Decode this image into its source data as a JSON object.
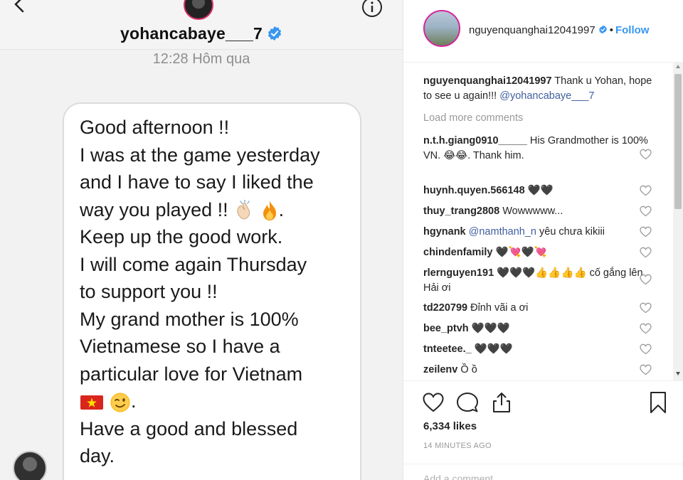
{
  "dm": {
    "username": "yohancabaye___7",
    "timestamp": "12:28 Hôm qua",
    "message": {
      "l1": "Good afternoon !!",
      "l2": "I was at the game yesterday",
      "l3": "and I have to say I liked the",
      "l4a": "way you played !! ",
      "l4b": ".",
      "l5": "Keep up the good work.",
      "l6": "I will come again Thursday",
      "l7": "to support you !!",
      "l8": "My grand mother is 100%",
      "l9": "Vietnamese so I have a",
      "l10": "particular love for Vietnam",
      "l11b": ".",
      "l12": "Have a good and blessed",
      "l13": "day."
    },
    "icons": [
      "back-arrow-icon",
      "info-icon",
      "verified-icon",
      "clap-emoji",
      "fire-emoji",
      "vietnam-flag-emoji",
      "wink-emoji"
    ]
  },
  "post": {
    "username": "nguyenquanghai12041997",
    "dot": "•",
    "follow_label": "Follow",
    "caption": {
      "user": "nguyenquanghai12041997",
      "text": " Thank u Yohan, hope to see u again!!! ",
      "mention": "@yohancabaye___7"
    },
    "load_more": "Load more comments",
    "comments": [
      {
        "user": "n.t.h.giang0910_____",
        "text": " His Grandmother is 100% VN. 😂😂. Thank him."
      },
      {
        "user": "huynh.quyen.566148",
        "text": " 🖤🖤"
      },
      {
        "user": "thuy_trang2808",
        "text": " Wowwwww..."
      },
      {
        "user": "hgynank",
        "mention": " @namthanh_n",
        "text": " yêu chưa kikiii"
      },
      {
        "user": "chindenfamily",
        "text": " 🖤💘🖤💘"
      },
      {
        "user": "rlernguyen191",
        "text": " 🖤🖤🖤👍👍👍👍 cố gắng lên Hải ơi"
      },
      {
        "user": "td220799",
        "text": " Đỉnh vãi a ơi"
      },
      {
        "user": "bee_ptvh",
        "text": " 🖤🖤🖤"
      },
      {
        "user": "tnteetee._",
        "text": " 🖤🖤🖤"
      },
      {
        "user": "zeilenv",
        "text": " Ồ ồ"
      }
    ],
    "likes": "6,334 likes",
    "time_ago": "14 MINUTES AGO",
    "add_comment_placeholder": "Add a comment..."
  },
  "colors": {
    "accent_blue": "#3897f0",
    "mention_blue": "#3f5f9f",
    "verified_blue": "#3897f0",
    "avatar_ring": "#d6249f",
    "muted_gray": "#999999"
  }
}
